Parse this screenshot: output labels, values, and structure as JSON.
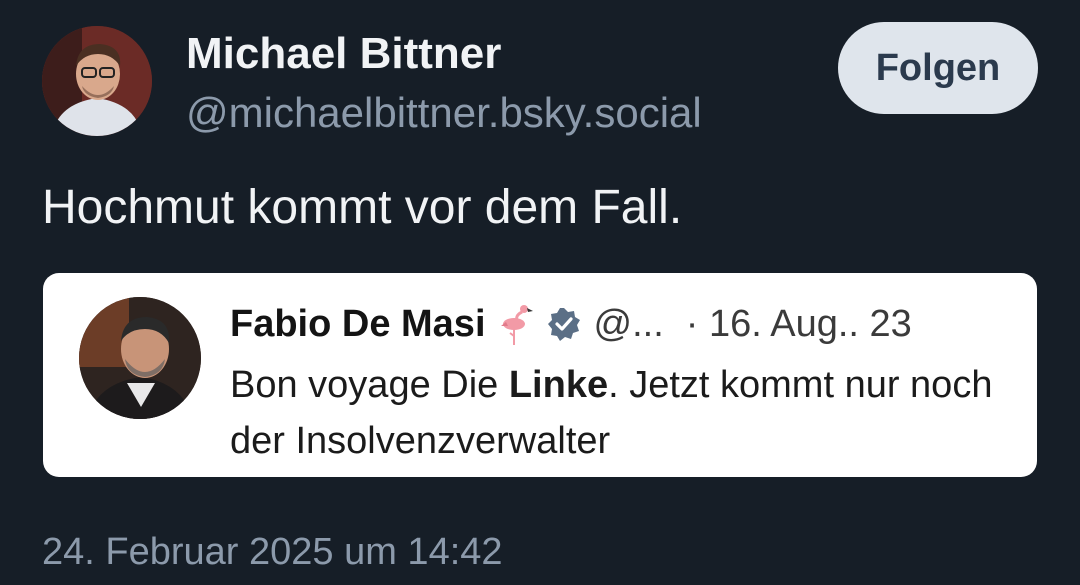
{
  "post": {
    "author_name": "Michael Bittner",
    "author_handle": "@michaelbittner.bsky.social",
    "follow_label": "Folgen",
    "text": "Hochmut kommt vor dem Fall.",
    "timestamp": "24. Februar 2025 um 14:42"
  },
  "embed": {
    "author_name": "Fabio De Masi",
    "emoji": "flamingo",
    "verified_icon": "verified-badge-icon",
    "handle": "@...",
    "date": "· 16. Aug.. 23",
    "text_before": "Bon voyage Die ",
    "text_bold": "Linke",
    "text_after": ". Jetzt kommt nur noch der Insolvenzverwalter"
  },
  "colors": {
    "background": "#161e27",
    "primary_text": "#f1f3f5",
    "secondary_text": "#8c9aab",
    "button_bg": "#dfe5ec",
    "button_text": "#2b3a4d",
    "card_bg": "#ffffff",
    "verified": "#5b6f86",
    "flamingo": "#f29aa6"
  }
}
